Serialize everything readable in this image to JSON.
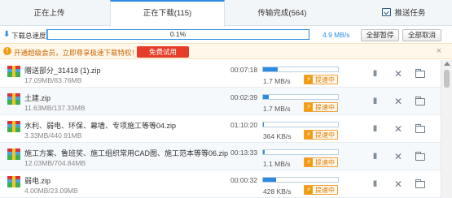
{
  "tabs": {
    "uploading": "正在上传",
    "downloading": "正在下载(115)",
    "completed": "传输完成(564)",
    "push": "推送任务"
  },
  "toolbar": {
    "total_label": "下载总速度",
    "total_percent": "0.1%",
    "total_progress": 0.001,
    "total_speed": "4.9 MB/s",
    "pause_all": "全部暂停",
    "cancel_all": "全部取消"
  },
  "vip": {
    "text": "开通超级会员，立即尊享极速下载特权！",
    "button": "免费试用",
    "close": "×"
  },
  "files": [
    {
      "name": "赠送部分_31418 (1).zip",
      "size": "17.09MB/83.76MB",
      "time": "00:07:18",
      "speed": "1.7 MB/s",
      "progress": 0.2,
      "accel": "提速中"
    },
    {
      "name": "土建.zip",
      "size": "11.63MB/137.33MB",
      "time": "00:02:39",
      "speed": "1.7 MB/s",
      "progress": 0.08,
      "accel": "提速中"
    },
    {
      "name": "水利、弱电、环保、幕墙、专项施工等等04.zip",
      "size": "3.33MB/440.91MB",
      "time": "01:10:20",
      "speed": "364 KB/s",
      "progress": 0.01,
      "accel": "提速中"
    },
    {
      "name": "施工方案、鲁班奖、施工组织常用CAD图、施工范本等等06.zip",
      "size": "12.03MB/704.84MB",
      "time": "00:13:33",
      "speed": "1.1 MB/s",
      "progress": 0.02,
      "accel": "提速中"
    },
    {
      "name": "弱电.zip",
      "size": "4.00MB/23.09MB",
      "time": "00:00:32",
      "speed": "428 KB/s",
      "progress": 0.17,
      "accel": "提速中"
    }
  ],
  "colors": {
    "accent": "#2c8ae0",
    "vip_button": "#e63d2b",
    "accel_border": "#f0a23a"
  }
}
